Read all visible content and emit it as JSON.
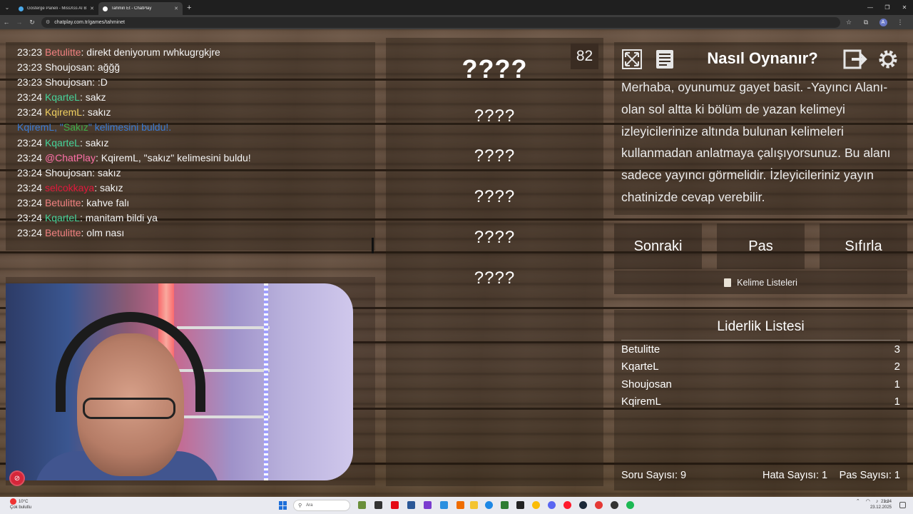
{
  "browser": {
    "tabs": [
      {
        "title": "Gösterge Paneli - MissXss AI B...",
        "active": false
      },
      {
        "title": "Tahmin Et - ChatPlay",
        "active": true
      }
    ],
    "url": "chatplay.com.tr/games/tahminet",
    "profile_initial": "A"
  },
  "chat": {
    "messages": [
      {
        "time": "23:23",
        "user": "Betulitte",
        "color": "#f08080",
        "text": ": direkt deniyorum rwhkugrgkjre"
      },
      {
        "time": "23:23",
        "user": "Shoujosan",
        "color": "#f4f4f4",
        "text": ": ağğğ"
      },
      {
        "time": "23:23",
        "user": "Shoujosan",
        "color": "#f4f4f4",
        "text": ": :D"
      },
      {
        "time": "23:24",
        "user": "KqarteL",
        "color": "#46d39a",
        "text": ": sakz"
      },
      {
        "time": "23:24",
        "user": "KqiremL",
        "color": "#f0d060",
        "text": ": sakız"
      },
      {
        "time": "23:24",
        "user": "@ChatPlay",
        "color": "#ff6fa8",
        "text": ": KqiremL, \"sakız\" kelimesini buldu!"
      },
      {
        "time": "23:24",
        "user": "Shoujosan",
        "color": "#f4f4f4",
        "text": ": sakız"
      },
      {
        "time": "23:24",
        "user": "selcokkaya",
        "color": "#e0193c",
        "text": ": sakız"
      },
      {
        "time": "23:24",
        "user": "Betulitte",
        "color": "#f08080",
        "text": ": kahve falı"
      },
      {
        "time": "23:24",
        "user": "KqarteL",
        "color": "#46d39a",
        "text": ": manitam bildi ya"
      },
      {
        "time": "23:24",
        "user": "Betulitte",
        "color": "#f08080",
        "text": ": olm nası"
      }
    ],
    "system_notice": {
      "before": "KqiremL, \"",
      "word": "Sakız",
      "after": "\" kelimesini buldu!."
    },
    "duplicate_line": {
      "time": "23:24",
      "user": "KqarteL",
      "text": ": sakız"
    }
  },
  "game": {
    "timer": "82",
    "main_word": "????",
    "forbidden_words": [
      "????",
      "????",
      "????",
      "????",
      "????"
    ]
  },
  "howto": {
    "title": "Nasıl Oynanır?",
    "text": "Merhaba, oyunumuz gayet basit. -Yayıncı Alanı- olan sol altta ki bölüm de yazan kelimeyi izleyicilerinize altında bulunan kelimeleri kullanmadan anlatmaya çalışıyorsunuz. Bu alanı sadece yayıncı görmelidir. İzleyicileriniz yayın chatinizde cevap verebilir."
  },
  "controls": {
    "next": "Sonraki",
    "pass": "Pas",
    "reset": "Sıfırla",
    "word_lists": "Kelime Listeleri"
  },
  "leaderboard": {
    "title": "Liderlik Listesi",
    "rows": [
      {
        "name": "Betulitte",
        "score": "3"
      },
      {
        "name": "KqarteL",
        "score": "2"
      },
      {
        "name": "Shoujosan",
        "score": "1"
      },
      {
        "name": "KqiremL",
        "score": "1"
      }
    ],
    "stats": {
      "questions": "Soru Sayısı: 9",
      "errors": "Hata Sayısı: 1",
      "passes": "Pas Sayısı: 1"
    }
  },
  "taskbar": {
    "weather_temp": "10°C",
    "weather_desc": "Çok bulutlu",
    "search_placeholder": "Ara",
    "time": "23:24",
    "date": "23.12.2025"
  }
}
